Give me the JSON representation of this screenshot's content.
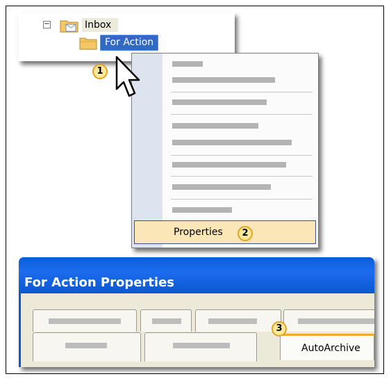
{
  "tree": {
    "inbox_label": "Inbox",
    "folder_label": "For Action"
  },
  "menu": {
    "properties_label": "Properties"
  },
  "callouts": {
    "one": "1",
    "two": "2",
    "three": "3"
  },
  "dialog": {
    "title": "For Action Properties",
    "active_tab_label": "AutoArchive"
  },
  "colors": {
    "selection": "#316ac5",
    "menu_highlight": "#fae6b6",
    "titlebar": "#1c6cee",
    "callout_fill": "#fde89a",
    "callout_border": "#e1a326",
    "active_tab_accent": "#f1a833"
  }
}
